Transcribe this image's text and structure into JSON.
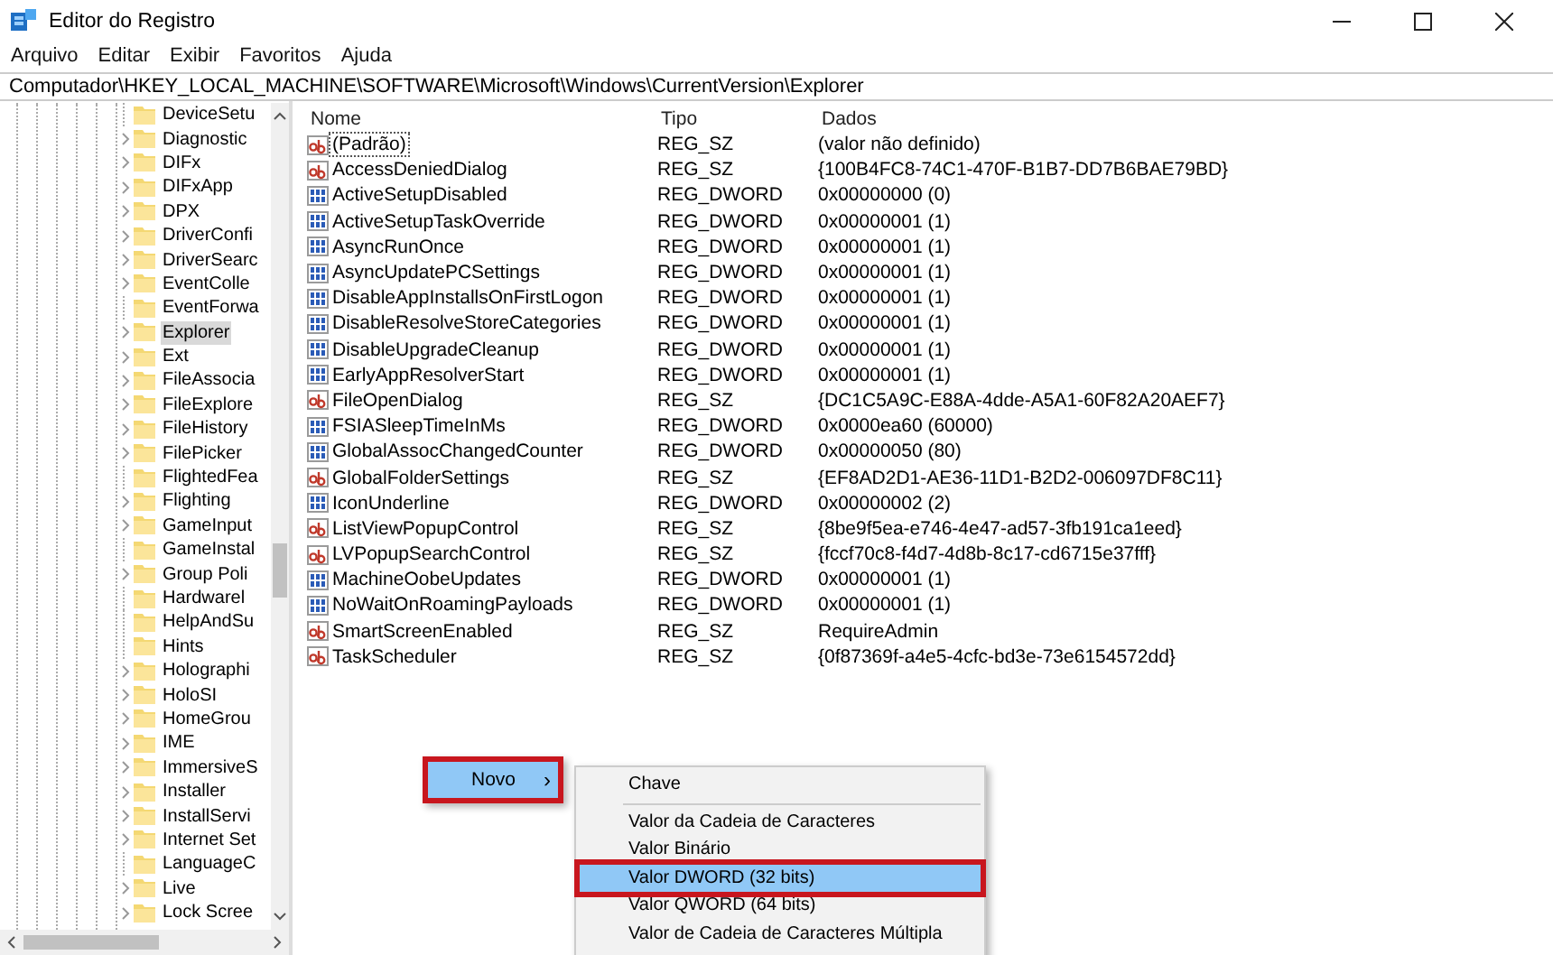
{
  "window": {
    "title": "Editor do Registro"
  },
  "menu_bar": [
    {
      "label": "Arquivo"
    },
    {
      "label": "Editar"
    },
    {
      "label": "Exibir"
    },
    {
      "label": "Favoritos"
    },
    {
      "label": "Ajuda"
    }
  ],
  "address": "Computador\\HKEY_LOCAL_MACHINE\\SOFTWARE\\Microsoft\\Windows\\CurrentVersion\\Explorer",
  "tree": {
    "items": [
      {
        "label": "DeviceSetu",
        "expandable": false,
        "selected": false
      },
      {
        "label": "Diagnostic",
        "expandable": true,
        "selected": false
      },
      {
        "label": "DIFx",
        "expandable": true,
        "selected": false
      },
      {
        "label": "DIFxApp",
        "expandable": true,
        "selected": false
      },
      {
        "label": "DPX",
        "expandable": true,
        "selected": false
      },
      {
        "label": "DriverConfi",
        "expandable": true,
        "selected": false
      },
      {
        "label": "DriverSearc",
        "expandable": true,
        "selected": false
      },
      {
        "label": "EventColle",
        "expandable": true,
        "selected": false
      },
      {
        "label": "EventForwa",
        "expandable": false,
        "selected": false
      },
      {
        "label": "Explorer",
        "expandable": true,
        "selected": true
      },
      {
        "label": "Ext",
        "expandable": true,
        "selected": false
      },
      {
        "label": "FileAssocia",
        "expandable": true,
        "selected": false
      },
      {
        "label": "FileExplore",
        "expandable": true,
        "selected": false
      },
      {
        "label": "FileHistory",
        "expandable": true,
        "selected": false
      },
      {
        "label": "FilePicker",
        "expandable": true,
        "selected": false
      },
      {
        "label": "FlightedFea",
        "expandable": false,
        "selected": false
      },
      {
        "label": "Flighting",
        "expandable": true,
        "selected": false
      },
      {
        "label": "GameInput",
        "expandable": true,
        "selected": false
      },
      {
        "label": "GameInstal",
        "expandable": false,
        "selected": false
      },
      {
        "label": "Group Poli",
        "expandable": true,
        "selected": false
      },
      {
        "label": "Hardwarel",
        "expandable": false,
        "selected": false
      },
      {
        "label": "HelpAndSu",
        "expandable": false,
        "selected": false
      },
      {
        "label": "Hints",
        "expandable": false,
        "selected": false
      },
      {
        "label": "Holographi",
        "expandable": true,
        "selected": false
      },
      {
        "label": "HoloSI",
        "expandable": true,
        "selected": false
      },
      {
        "label": "HomeGrou",
        "expandable": true,
        "selected": false
      },
      {
        "label": "IME",
        "expandable": true,
        "selected": false
      },
      {
        "label": "ImmersiveS",
        "expandable": true,
        "selected": false
      },
      {
        "label": "Installer",
        "expandable": true,
        "selected": false
      },
      {
        "label": "InstallServi",
        "expandable": true,
        "selected": false
      },
      {
        "label": "Internet Set",
        "expandable": true,
        "selected": false
      },
      {
        "label": "LanguageC",
        "expandable": false,
        "selected": false
      },
      {
        "label": "Live",
        "expandable": true,
        "selected": false
      },
      {
        "label": "Lock Scree",
        "expandable": true,
        "selected": false
      }
    ]
  },
  "table": {
    "columns": [
      "Nome",
      "Tipo",
      "Dados"
    ],
    "rows": [
      {
        "kind": "string",
        "name": "(Padrão)",
        "type": "REG_SZ",
        "data": "(valor não definido)",
        "focused": true
      },
      {
        "kind": "string",
        "name": "AccessDeniedDialog",
        "type": "REG_SZ",
        "data": "{100B4FC8-74C1-470F-B1B7-DD7B6BAE79BD}",
        "focused": false
      },
      {
        "kind": "binary",
        "name": "ActiveSetupDisabled",
        "type": "REG_DWORD",
        "data": "0x00000000 (0)",
        "focused": false
      },
      {
        "kind": "binary",
        "name": "ActiveSetupTaskOverride",
        "type": "REG_DWORD",
        "data": "0x00000001 (1)",
        "focused": false
      },
      {
        "kind": "binary",
        "name": "AsyncRunOnce",
        "type": "REG_DWORD",
        "data": "0x00000001 (1)",
        "focused": false
      },
      {
        "kind": "binary",
        "name": "AsyncUpdatePCSettings",
        "type": "REG_DWORD",
        "data": "0x00000001 (1)",
        "focused": false
      },
      {
        "kind": "binary",
        "name": "DisableAppInstallsOnFirstLogon",
        "type": "REG_DWORD",
        "data": "0x00000001 (1)",
        "focused": false
      },
      {
        "kind": "binary",
        "name": "DisableResolveStoreCategories",
        "type": "REG_DWORD",
        "data": "0x00000001 (1)",
        "focused": false
      },
      {
        "kind": "binary",
        "name": "DisableUpgradeCleanup",
        "type": "REG_DWORD",
        "data": "0x00000001 (1)",
        "focused": false
      },
      {
        "kind": "binary",
        "name": "EarlyAppResolverStart",
        "type": "REG_DWORD",
        "data": "0x00000001 (1)",
        "focused": false
      },
      {
        "kind": "string",
        "name": "FileOpenDialog",
        "type": "REG_SZ",
        "data": "{DC1C5A9C-E88A-4dde-A5A1-60F82A20AEF7}",
        "focused": false
      },
      {
        "kind": "binary",
        "name": "FSIASleepTimeInMs",
        "type": "REG_DWORD",
        "data": "0x0000ea60 (60000)",
        "focused": false
      },
      {
        "kind": "binary",
        "name": "GlobalAssocChangedCounter",
        "type": "REG_DWORD",
        "data": "0x00000050 (80)",
        "focused": false
      },
      {
        "kind": "string",
        "name": "GlobalFolderSettings",
        "type": "REG_SZ",
        "data": "{EF8AD2D1-AE36-11D1-B2D2-006097DF8C11}",
        "focused": false
      },
      {
        "kind": "binary",
        "name": "IconUnderline",
        "type": "REG_DWORD",
        "data": "0x00000002 (2)",
        "focused": false
      },
      {
        "kind": "string",
        "name": "ListViewPopupControl",
        "type": "REG_SZ",
        "data": "{8be9f5ea-e746-4e47-ad57-3fb191ca1eed}",
        "focused": false
      },
      {
        "kind": "string",
        "name": "LVPopupSearchControl",
        "type": "REG_SZ",
        "data": "{fccf70c8-f4d7-4d8b-8c17-cd6715e37fff}",
        "focused": false
      },
      {
        "kind": "binary",
        "name": "MachineOobeUpdates",
        "type": "REG_DWORD",
        "data": "0x00000001 (1)",
        "focused": false
      },
      {
        "kind": "binary",
        "name": "NoWaitOnRoamingPayloads",
        "type": "REG_DWORD",
        "data": "0x00000001 (1)",
        "focused": false
      },
      {
        "kind": "string",
        "name": "SmartScreenEnabled",
        "type": "REG_SZ",
        "data": "RequireAdmin",
        "focused": false
      },
      {
        "kind": "string",
        "name": "TaskScheduler",
        "type": "REG_SZ",
        "data": "{0f87369f-a4e5-4cfc-bd3e-73e6154572dd}",
        "focused": false
      }
    ]
  },
  "context_menu": {
    "items": [
      {
        "label": "Novo",
        "submenu_arrow": "›",
        "selected": true,
        "outlined": true
      }
    ]
  },
  "submenu": {
    "items": [
      {
        "kind": "item",
        "label": "Chave",
        "selected": false,
        "outlined": false
      },
      {
        "kind": "separator"
      },
      {
        "kind": "item",
        "label": "Valor da Cadeia de Caracteres",
        "selected": false,
        "outlined": false
      },
      {
        "kind": "item",
        "label": "Valor Binário",
        "selected": false,
        "outlined": false
      },
      {
        "kind": "item",
        "label": "Valor DWORD (32 bits)",
        "selected": true,
        "outlined": true
      },
      {
        "kind": "item",
        "label": "Valor QWORD (64 bits)",
        "selected": false,
        "outlined": false
      },
      {
        "kind": "item",
        "label": "Valor de Cadeia de Caracteres Múltipla",
        "selected": false,
        "outlined": false
      }
    ]
  }
}
